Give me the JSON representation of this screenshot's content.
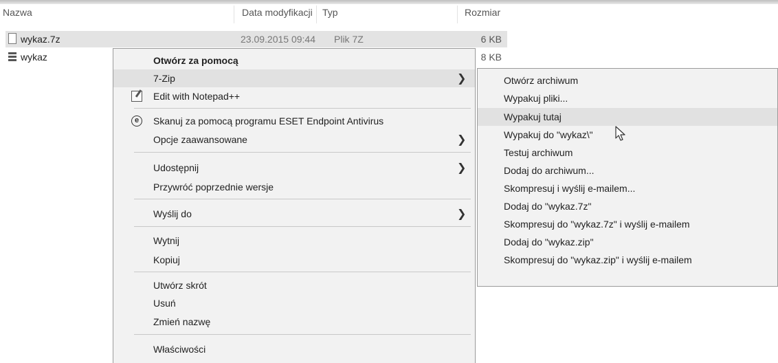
{
  "columns": {
    "name": "Nazwa",
    "date": "Data modyfikacji",
    "type": "Typ",
    "size": "Rozmiar"
  },
  "files": [
    {
      "name": "wykaz.7z",
      "date": "23.09.2015 09:44",
      "type": "Plik 7Z",
      "size": "6 KB",
      "selected": true
    },
    {
      "name": "wykaz",
      "date": "",
      "type": "",
      "size": "8 KB",
      "selected": false
    }
  ],
  "context_menu": {
    "open_with": "Otwórz za pomocą",
    "sevenzip": "7-Zip",
    "edit_notepad": "Edit with Notepad++",
    "eset_scan": "Skanuj za pomocą programu ESET Endpoint Antivirus",
    "advanced": "Opcje zaawansowane",
    "share": "Udostępnij",
    "restore": "Przywróć poprzednie wersje",
    "send_to": "Wyślij do",
    "cut": "Wytnij",
    "copy": "Kopiuj",
    "shortcut": "Utwórz skrót",
    "delete": "Usuń",
    "rename": "Zmień nazwę",
    "properties": "Właściwości"
  },
  "submenu": {
    "items": [
      "Otwórz archiwum",
      "Wypakuj pliki...",
      "Wypakuj tutaj",
      "Wypakuj do \"wykaz\\\"",
      "Testuj archiwum",
      "Dodaj do archiwum...",
      "Skompresuj i wyślij e-mailem...",
      "Dodaj do \"wykaz.7z\"",
      "Skompresuj do \"wykaz.7z\" i wyślij e-mailem",
      "Dodaj do \"wykaz.zip\"",
      "Skompresuj do \"wykaz.zip\" i wyślij e-mailem"
    ]
  },
  "icons": {
    "arrow": "submenu-arrow-icon",
    "notepad": "notepad-icon",
    "eset": "eset-icon",
    "eset_glyph": "e"
  }
}
